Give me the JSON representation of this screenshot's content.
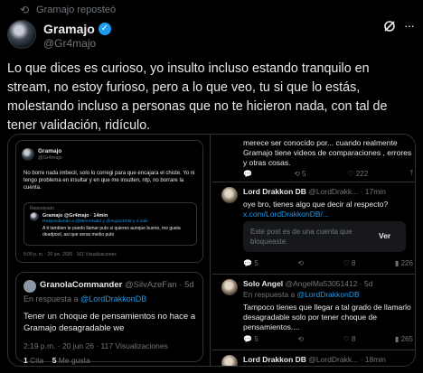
{
  "repost": {
    "label": "Gramajo reposteó",
    "icon": "repost-icon"
  },
  "author": {
    "name": "Gramajo",
    "verified_icon": "verified-icon",
    "handle": "@Gr4majo",
    "verified_check": "✓"
  },
  "header_icons": {
    "grok": "grok-icon",
    "more": "···"
  },
  "tweet": {
    "text": "Lo que dices es curioso, yo insulto incluso estando tranquilo en stream, no estoy furioso, pero a lo que veo, tu si que lo estás, molestando incluso a personas que no te hicieron nada, con tal de tener validación, ridículo."
  },
  "media_left": {
    "screenshot": {
      "name": "Gramajo",
      "handle": "@Gr4majo",
      "text": "No borre nada imbecil, solo lo corregi para que encajara el chiste. Yo ni tengo problema en insultar y en que me insulten, ntp, no borrare la cuenta.",
      "quote_repost": "Reposteado",
      "quote_name": "Gramajo @Gr4majo · 14min",
      "quote_reply": "Respondiendo a @MevArtw62 y @Argo21038 y 4 más",
      "quote_text": "A ti tambien te puedo llamar puto si quieres aunque bueno, me gusta deadpool, asi que seras medio puto",
      "meta": "8:09 p. m. · 20 jun. 2026 · 161 Visualizaciones"
    },
    "reply": {
      "name": "GranolaCommander",
      "handle": "@SilvAzeFan · 5d",
      "reply_prefix": "En respuesta a ",
      "reply_to": "@LordDrakkonDB",
      "text": "Tener un choque de pensamientos no hace a Gramajo desagradable we",
      "meta": "2:19 p.m. · 20 jun 26 · 117 Visualizaciones",
      "quotes_count": "1",
      "quotes_label": "Cita",
      "likes_count": "5",
      "likes_label": "Me gusta"
    }
  },
  "media_right": {
    "top_text": "merece ser conocido por... cuando realmente Gramajo tiene videos de comparaciones , errores y otras cosas.",
    "top_actions": {
      "replies": "5",
      "reposts": "",
      "likes": "222",
      "icon_bookmark": "bookmark-icon"
    },
    "post1": {
      "name": "Lord Drakkon DB",
      "handle": "@LordDrakk... · 17min",
      "text": "oye bro, tienes algo que decir al respecto?",
      "link": "x.com/LordDrakkonDB/...",
      "unavailable": "Este post es de una cuenta que bloqueaste.",
      "view_button": "Ver",
      "actions": {
        "replies": "5",
        "likes": "8",
        "views": "226"
      }
    },
    "post2": {
      "name": "Solo Angel",
      "handle": "@AngelMa53051412 · 5d",
      "reply_prefix": "En respuesta a ",
      "reply_to": "@LordDrakkonDB",
      "text": "Tampoco tienes que llegar a tal grado de llamarlo desagradable solo por tener choque de pensamientos....",
      "actions": {
        "replies": "5",
        "likes": "8",
        "views": "265"
      }
    },
    "post3": {
      "name": "Lord Drakkon DB",
      "handle": "@LordDrakk... · 18min"
    }
  }
}
